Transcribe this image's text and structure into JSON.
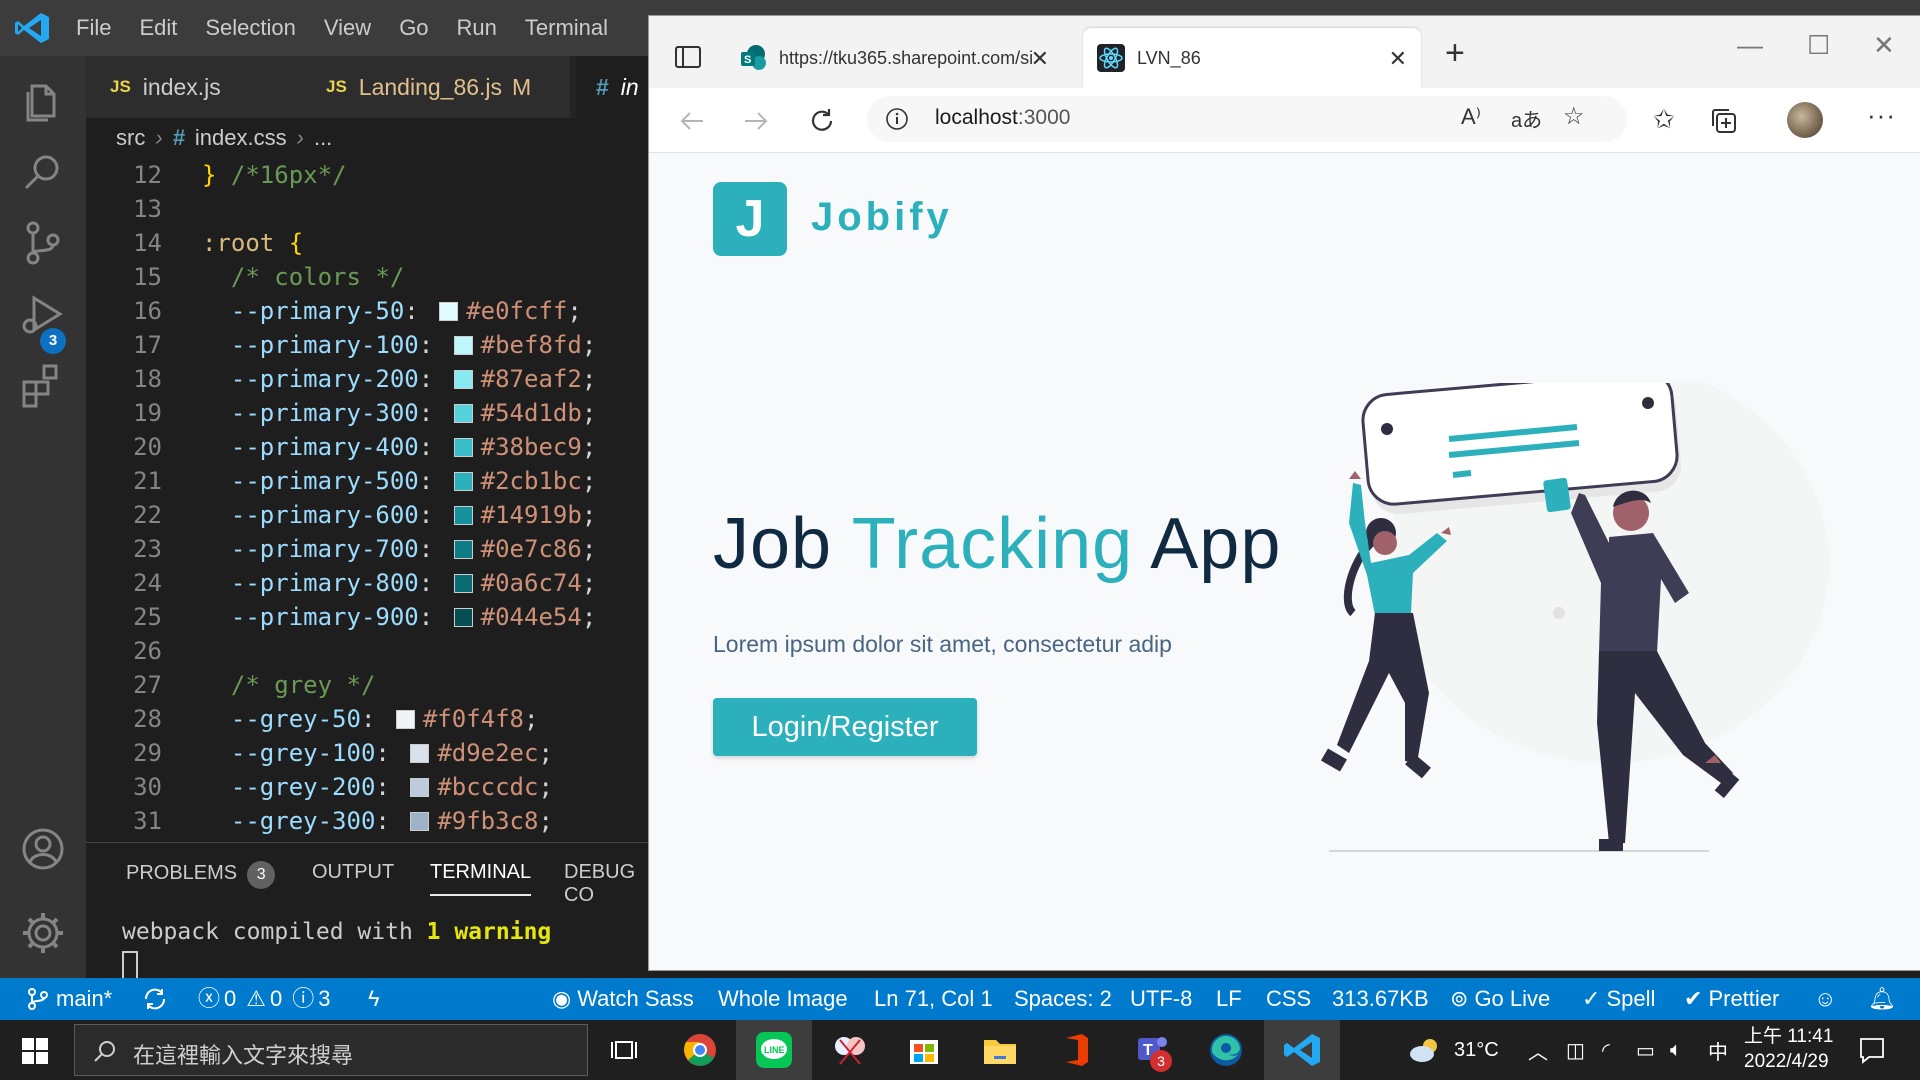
{
  "vscode": {
    "menu": [
      "File",
      "Edit",
      "Selection",
      "View",
      "Go",
      "Run",
      "Terminal"
    ],
    "scm_badge": "3",
    "tabs": [
      {
        "type": "JS",
        "name": "index.js",
        "modified": ""
      },
      {
        "type": "JS",
        "name": "Landing_86.js",
        "modified": "M"
      },
      {
        "type": "#",
        "name": "in"
      }
    ],
    "breadcrumb": {
      "folder": "src",
      "file": "index.css",
      "more": "..."
    },
    "lines": [
      {
        "n": "12",
        "brace": "}",
        "comment": " /*16px*/"
      },
      {
        "n": "13"
      },
      {
        "n": "14",
        "selector": ":root",
        "brace": " {"
      },
      {
        "n": "15",
        "comment": "/* colors */"
      },
      {
        "n": "16",
        "prop": "--primary-50",
        "value": "#e0fcff",
        "color": "#e0fcff"
      },
      {
        "n": "17",
        "prop": "--primary-100",
        "value": "#bef8fd",
        "color": "#bef8fd"
      },
      {
        "n": "18",
        "prop": "--primary-200",
        "value": "#87eaf2",
        "color": "#87eaf2"
      },
      {
        "n": "19",
        "prop": "--primary-300",
        "value": "#54d1db",
        "color": "#54d1db"
      },
      {
        "n": "20",
        "prop": "--primary-400",
        "value": "#38bec9",
        "color": "#38bec9"
      },
      {
        "n": "21",
        "prop": "--primary-500",
        "value": "#2cb1bc",
        "color": "#2cb1bc"
      },
      {
        "n": "22",
        "prop": "--primary-600",
        "value": "#14919b",
        "color": "#14919b"
      },
      {
        "n": "23",
        "prop": "--primary-700",
        "value": "#0e7c86",
        "color": "#0e7c86"
      },
      {
        "n": "24",
        "prop": "--primary-800",
        "value": "#0a6c74",
        "color": "#0a6c74"
      },
      {
        "n": "25",
        "prop": "--primary-900",
        "value": "#044e54",
        "color": "#044e54"
      },
      {
        "n": "26"
      },
      {
        "n": "27",
        "comment": "/* grey */"
      },
      {
        "n": "28",
        "prop": "--grey-50",
        "value": "#f0f4f8",
        "color": "#f0f4f8"
      },
      {
        "n": "29",
        "prop": "--grey-100",
        "value": "#d9e2ec",
        "color": "#d9e2ec"
      },
      {
        "n": "30",
        "prop": "--grey-200",
        "value": "#bcccdc",
        "color": "#bcccdc"
      },
      {
        "n": "31",
        "prop": "--grey-300",
        "value": "#9fb3c8",
        "color": "#9fb3c8"
      }
    ],
    "panel": {
      "problems": "PROBLEMS",
      "problems_count": "3",
      "output": "OUTPUT",
      "terminal": "TERMINAL",
      "debug": "DEBUG CO",
      "term_prefix": "webpack compiled with ",
      "term_warn": "1 warning"
    }
  },
  "statusbar": {
    "branch": "main*",
    "errors": "0",
    "warnings": "0",
    "infos": "3",
    "watch_sass": "Watch Sass",
    "whole_image": "Whole Image",
    "position": "Ln 71, Col 1",
    "spaces": "Spaces: 2",
    "encoding": "UTF-8",
    "eol": "LF",
    "language": "CSS",
    "size": "313.67KB",
    "go_live": "Go Live",
    "spell": "Spell",
    "prettier": "Prettier"
  },
  "browser": {
    "tab1_title": "https://tku365.sharepoint.com/si",
    "tab2_title": "LVN_86",
    "url_host": "localhost",
    "url_port": ":3000"
  },
  "landing": {
    "logo_letter": "J",
    "logo_name": "Jobify",
    "title_part1": "Job ",
    "title_accent": "Tracking",
    "title_part2": " App",
    "subtitle": "Lorem ipsum dolor sit amet, consectetur adip",
    "button": "Login/Register",
    "accent_color": "#2cb1bc"
  },
  "taskbar": {
    "search_placeholder": "在這裡輸入文字來搜尋",
    "teams_badge": "3",
    "weather": "31°C",
    "ime": "中",
    "time": "上午 11:41",
    "date": "2022/4/29"
  }
}
